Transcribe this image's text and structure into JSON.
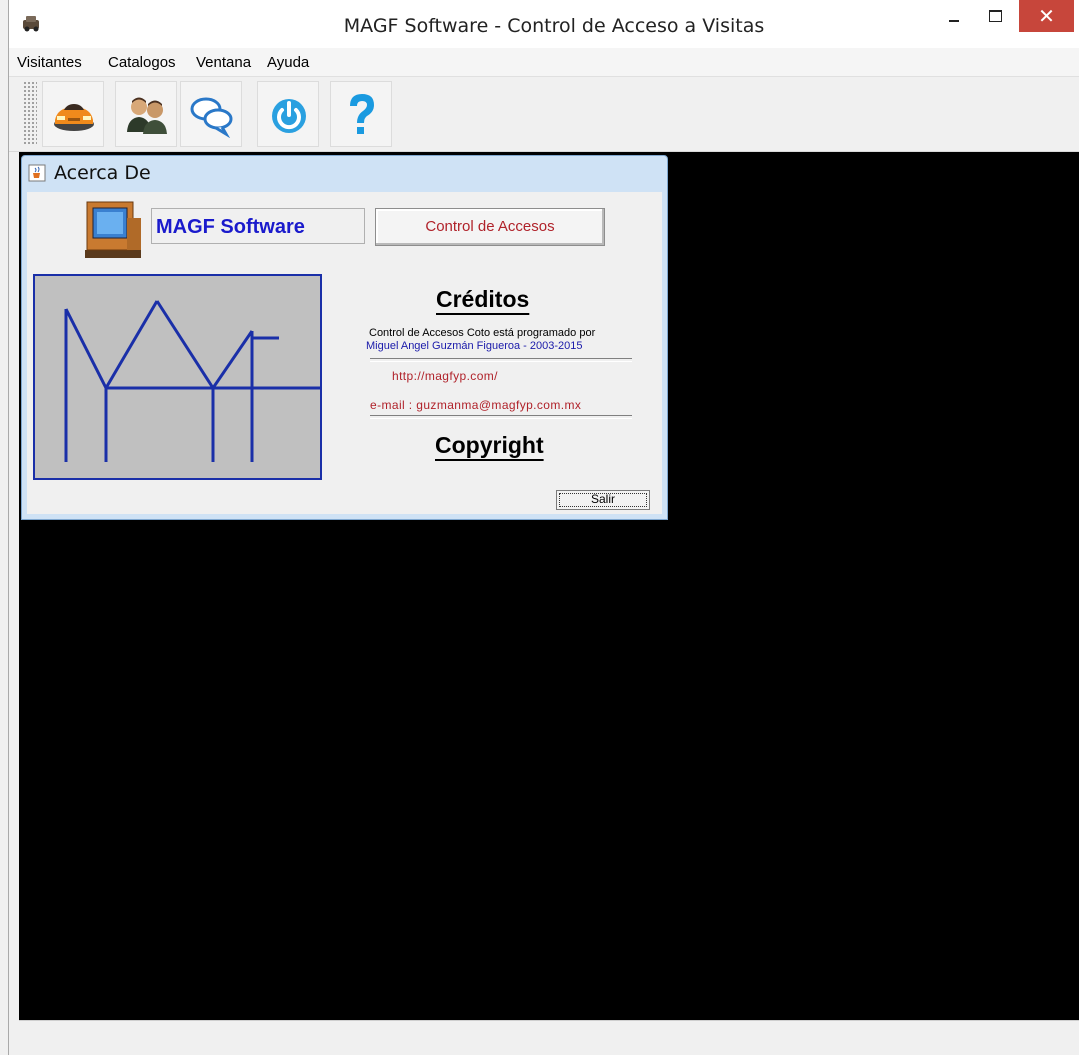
{
  "window": {
    "title": "MAGF Software - Control de Acceso a Visitas",
    "close_glyph": "✕"
  },
  "menu": {
    "items": [
      "Visitantes",
      "Catalogos",
      "Ventana",
      "Ayuda"
    ]
  },
  "toolbar": {
    "buttons": [
      "car-icon",
      "users-icon",
      "chat-bubbles-icon",
      "power-icon",
      "help-icon"
    ]
  },
  "dialog": {
    "title": "Acerca De",
    "brand": "MAGF Software",
    "product_button": "Control de Accesos",
    "credits_heading": "Créditos",
    "credits_line1": "Control de Accesos Coto está programado por",
    "credits_line2": "Miguel Angel Guzmán Figueroa - 2003-2015",
    "url": "http://magfyp.com/",
    "email": "e-mail : guzmanma@magfyp.com.mx",
    "copyright_heading": "Copyright",
    "exit_button": "Salir"
  },
  "colors": {
    "desktop": "#000000",
    "brand_text": "#1a1acc",
    "accent_red": "#b0222a",
    "logo_lines": "#1a2fa8",
    "close_button": "#c7463b"
  }
}
